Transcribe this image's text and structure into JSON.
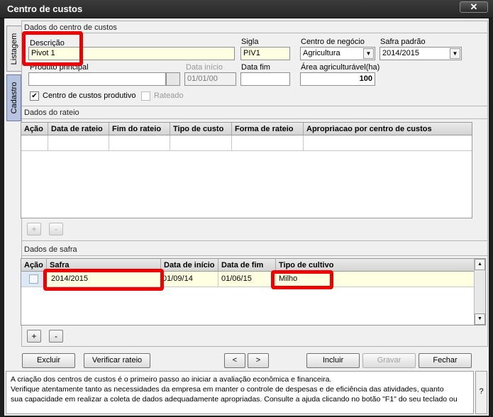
{
  "window": {
    "title": "Centro de custos",
    "close_symbol": "✕"
  },
  "side_tabs": {
    "listagem": "Listagem",
    "cadastro": "Cadastro"
  },
  "dados_centro": {
    "section_title": "Dados do centro de custos",
    "descricao_label": "Descrição",
    "descricao_value": "Pivot 1",
    "sigla_label": "Sigla",
    "sigla_value": "PIV1",
    "centro_negocio_label": "Centro de negócio",
    "centro_negocio_value": "Agricultura",
    "safra_padrao_label": "Safra padrão",
    "safra_padrao_value": "2014/2015",
    "produto_label": "Produto principal",
    "produto_value": "",
    "data_inicio_label": "Data início",
    "data_inicio_value": "01/01/00",
    "data_fim_label": "Data fim",
    "data_fim_value": "",
    "area_label": "Área agriculturável(ha)",
    "area_value": "100",
    "produtivo_label": "Centro de custos produtivo",
    "produtivo_checked": "✔",
    "rateado_label": "Rateado"
  },
  "dados_rateio": {
    "section_title": "Dados do rateio",
    "columns": [
      "Ação",
      "Data de rateio",
      "Fim do rateio",
      "Tipo de custo",
      "Forma de rateio",
      "Apropriacao por centro de custos"
    ],
    "add": "+",
    "remove": "-"
  },
  "dados_safra": {
    "section_title": "Dados de safra",
    "columns": [
      "Ação",
      "Safra",
      "Data de início",
      "Data de fim",
      "Tipo de cultivo"
    ],
    "rows": [
      {
        "safra": "2014/2015",
        "inicio": "01/09/14",
        "fim": "01/06/15",
        "cultivo": "Milho"
      }
    ],
    "add": "+",
    "remove": "-",
    "scroll_up": "▲",
    "scroll_down": "▼"
  },
  "actions": {
    "excluir": "Excluir",
    "verificar": "Verificar rateio",
    "prev": "<",
    "next": ">",
    "incluir": "Incluir",
    "gravar": "Gravar",
    "fechar": "Fechar"
  },
  "help": {
    "line1": "A criação dos centros de custos é o primeiro passo ao iniciar a avaliação econômica e financeira.",
    "line2": "Verifique atentamente tanto as necessidades da empresa em manter o controle de despesas e de eficiência das atividades, quanto",
    "line3": "sua capacidade em realizar a coleta de dados adequadamente apropriadas. Consulte a ajuda clicando no botão \"F1\" do seu teclado ou",
    "question": "?"
  },
  "colors": {
    "highlight": "#ee0000",
    "input_yellow": "#ffffe1",
    "row_yellow": "#ffffe1"
  }
}
